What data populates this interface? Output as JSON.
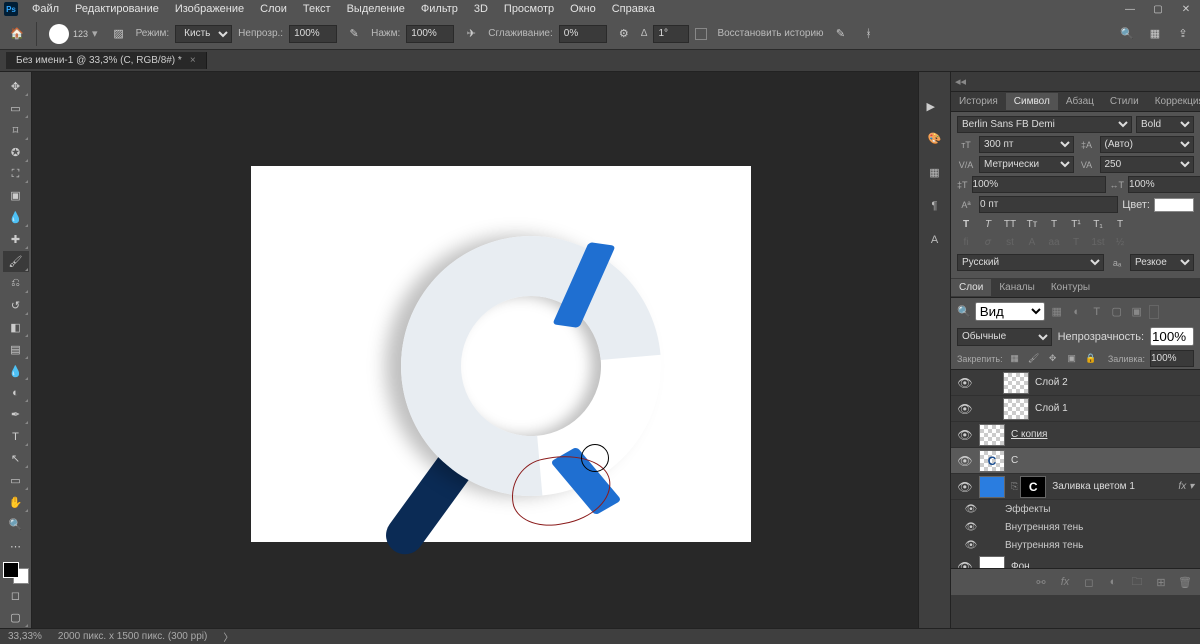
{
  "app": {
    "logo": "Ps"
  },
  "menu": [
    "Файл",
    "Редактирование",
    "Изображение",
    "Слои",
    "Текст",
    "Выделение",
    "Фильтр",
    "3D",
    "Просмотр",
    "Окно",
    "Справка"
  ],
  "options": {
    "brush_size": "123",
    "mode_label": "Режим:",
    "mode_value": "Кисть",
    "opacity_label": "Непрозр.:",
    "opacity_value": "100%",
    "flow_label": "Нажм:",
    "flow_value": "100%",
    "smoothing_label": "Сглаживание:",
    "smoothing_value": "0%",
    "angle_label": "Δ",
    "angle_value": "1°",
    "restore_history": "Восстановить историю"
  },
  "doc": {
    "tab_title": "Без имени-1 @ 33,3% (C, RGB/8#) *"
  },
  "panels_row1": [
    "История",
    "Символ",
    "Абзац",
    "Стили",
    "Коррекция"
  ],
  "panels_row1_active": 1,
  "character": {
    "font": "Berlin Sans FB Demi",
    "style": "Bold",
    "size": "300 пт",
    "leading": "(Авто)",
    "kerning": "Метрически",
    "tracking": "250",
    "vscale": "100%",
    "hscale": "100%",
    "baseline": "0 пт",
    "color_label": "Цвет:",
    "type_buttons": [
      "T",
      "T",
      "TT",
      "Tт",
      "T",
      "T¹",
      "T₁",
      "T"
    ],
    "ot_buttons": [
      "fi",
      "𝜎",
      "st",
      "A",
      "aa",
      "T",
      "1st",
      "½"
    ],
    "language": "Русский",
    "aa": "Резкое"
  },
  "panels_row2": [
    "Слои",
    "Каналы",
    "Контуры"
  ],
  "panels_row2_active": 0,
  "layers": {
    "filter_label": "Вид",
    "blend": "Обычные",
    "opacity_label": "Непрозрачность:",
    "opacity_value": "100%",
    "lock_label": "Закрепить:",
    "fill_label": "Заливка:",
    "fill_value": "100%",
    "items": [
      {
        "name": "Слой 2",
        "thumb": "checker"
      },
      {
        "name": "Слой 1",
        "thumb": "checker"
      },
      {
        "name": "С копия",
        "thumb": "checker",
        "link": true
      },
      {
        "name": "С",
        "thumb": "c",
        "selected": true
      },
      {
        "name": "Заливка цветом 1",
        "thumb": "blue",
        "mask": "C",
        "fx": true
      },
      {
        "name": "Фон",
        "thumb": "white"
      }
    ],
    "effects_header": "Эффекты",
    "effect1": "Внутренняя тень",
    "effect2": "Внутренняя тень"
  },
  "status": {
    "zoom": "33,33%",
    "docinfo": "2000 пикс. x 1500 пикс. (300 ppi)"
  }
}
